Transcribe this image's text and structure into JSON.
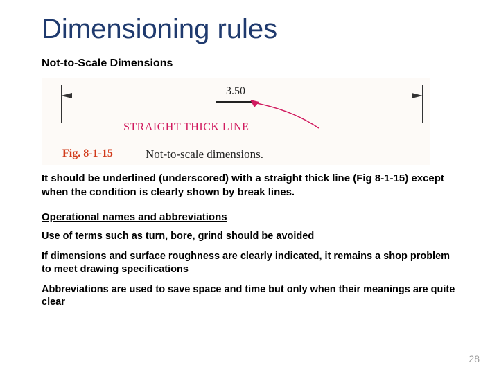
{
  "title": "Dimensioning rules",
  "subtitle": "Not-to-Scale Dimensions",
  "figure": {
    "dim_value": "3.50",
    "straight_label": "STRAIGHT THICK LINE",
    "fig_label": "Fig. 8-1-15",
    "fig_caption": "Not-to-scale dimensions."
  },
  "para1": "It should be underlined (underscored) with a straight thick line (Fig 8-1-15) except when the condition is clearly shown by break lines.",
  "section2": "Operational names and abbreviations",
  "bullet1": "Use of terms such as turn, bore, grind should be avoided",
  "bullet2": "If dimensions and surface roughness are clearly indicated, it remains a shop problem to meet drawing specifications",
  "bullet3": "Abbreviations are used to save space and time but only when their meanings are quite clear",
  "page_number": "28"
}
